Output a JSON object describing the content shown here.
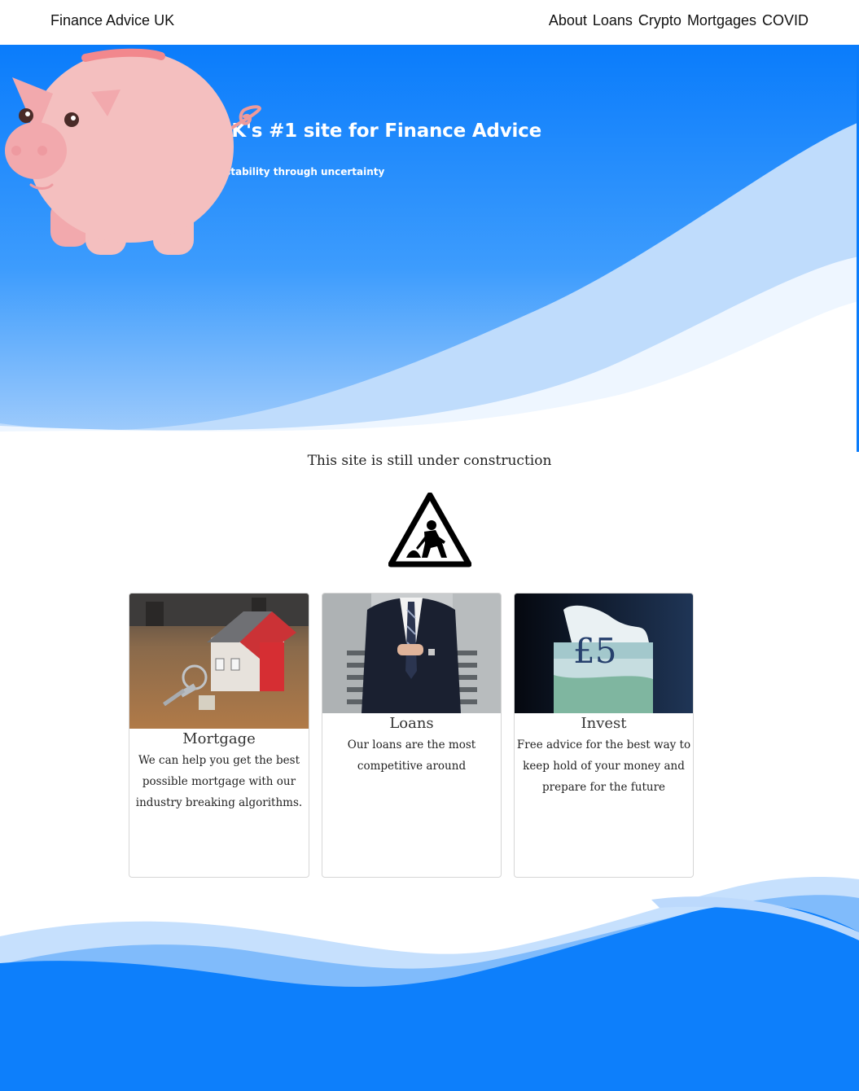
{
  "navbar": {
    "brand": "Finance Advice UK",
    "links": [
      "About",
      "Loans",
      "Crypto",
      "Mortgages",
      "COVID"
    ]
  },
  "hero": {
    "title": "The UK's #1 site for Finance Advice",
    "subtitle": "Financial stability through uncertainty"
  },
  "construction": {
    "message": "This site is still under construction",
    "icon": "construction-sign-icon"
  },
  "cards": [
    {
      "title": "Mortgage",
      "text": "We can help you get the best possible mortgage with our industry breaking algorithms.",
      "image": "house-with-keys"
    },
    {
      "title": "Loans",
      "text": "Our loans are the most competitive around",
      "image": "businessman-in-suit"
    },
    {
      "title": "Invest",
      "text": "Free advice for the best way to keep hold of your money and prepare for the future",
      "image": "five-pound-note"
    }
  ],
  "colors": {
    "primary_blue": "#007bff",
    "light_blue": "#bfdcfc",
    "pig_pink": "#f4bfbf"
  }
}
